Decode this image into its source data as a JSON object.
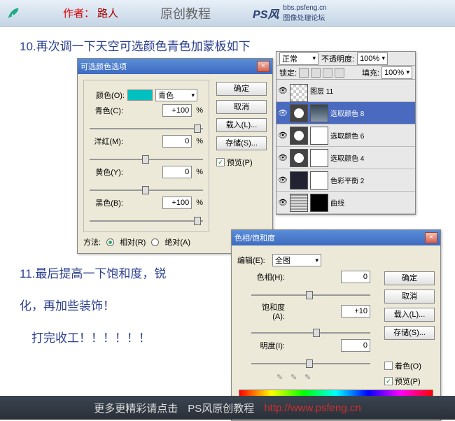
{
  "header": {
    "author_label": "作者：",
    "author_name": "路人",
    "title": "原创教程",
    "logo": "PS风",
    "logo_url": "bbs.psfeng.cn",
    "logo_sub": "图像处理论坛"
  },
  "step10": "10.再次调一下天空可选颜色青色加蒙板如下",
  "step11a": "11.最后提高一下饱和度，锐",
  "step11b": "化，再加些装饰！",
  "step11c": "　打完收工！！！！！！",
  "selective": {
    "title": "可选颜色选项",
    "color_lbl": "颜色(O):",
    "color_val": "青色",
    "cyan_lbl": "青色(C):",
    "cyan_val": "+100",
    "mag_lbl": "洋红(M):",
    "mag_val": "0",
    "yel_lbl": "黄色(Y):",
    "yel_val": "0",
    "blk_lbl": "黑色(B):",
    "blk_val": "+100",
    "pct": "%",
    "method_lbl": "方法:",
    "rel": "相对(R)",
    "abs": "绝对(A)",
    "ok": "确定",
    "cancel": "取消",
    "load": "载入(L)...",
    "save": "存储(S)...",
    "preview": "预览(P)"
  },
  "layers": {
    "mode": "正常",
    "opacity_lbl": "不透明度:",
    "opacity": "100%",
    "lock_lbl": "锁定:",
    "fill_lbl": "填充:",
    "fill": "100%",
    "items": [
      {
        "name": "图层 11",
        "type": "chk"
      },
      {
        "name": "选取颜色 8",
        "type": "sel"
      },
      {
        "name": "选取颜色 6",
        "type": "adj"
      },
      {
        "name": "选取颜色 4",
        "type": "adj"
      },
      {
        "name": "色彩平衡 2",
        "type": "adj"
      },
      {
        "name": "曲线",
        "type": "adj"
      }
    ]
  },
  "hue": {
    "title": "色相/饱和度",
    "edit_lbl": "编辑(E):",
    "edit_val": "全图",
    "hue_lbl": "色相(H):",
    "hue_val": "0",
    "sat_lbl": "饱和度(A):",
    "sat_val": "+10",
    "lig_lbl": "明度(I):",
    "lig_val": "0",
    "ok": "确定",
    "cancel": "取消",
    "load": "载入(L)...",
    "save": "存储(S)...",
    "colorize": "着色(O)",
    "preview": "预览(P)"
  },
  "footer": {
    "t1": "更多更精彩请点击",
    "t2": "PS风原创教程",
    "url": "http://www.psfeng.cn"
  }
}
